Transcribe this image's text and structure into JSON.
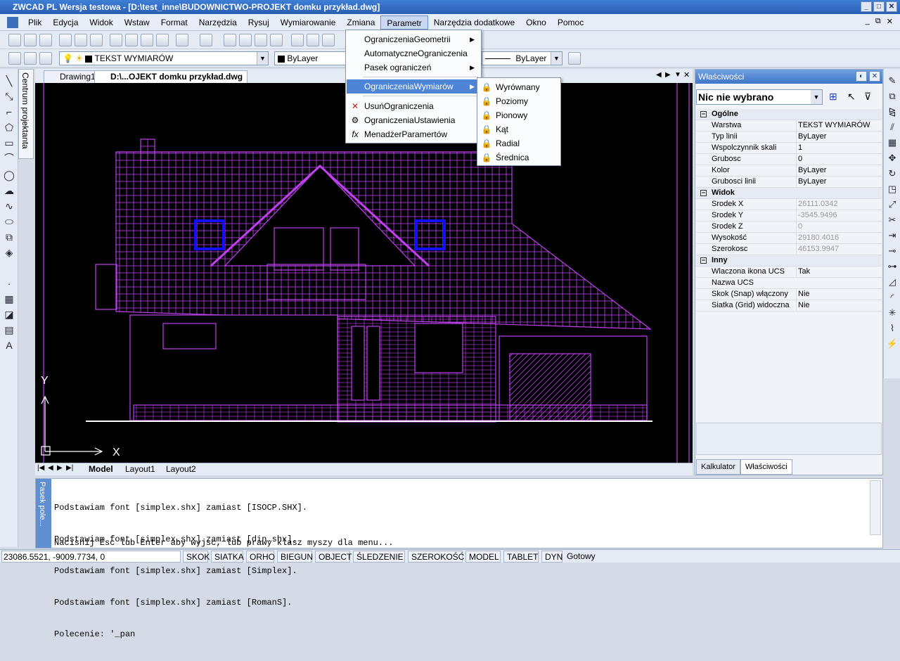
{
  "window": {
    "title": "ZWCAD PL Wersja testowa - [D:\\test_inne\\BUDOWNICTWO-PROJEKT domku przykład.dwg]",
    "min_label": "_",
    "max_label": "□",
    "close_label": "✕"
  },
  "menu": {
    "items": [
      "Plik",
      "Edycja",
      "Widok",
      "Wstaw",
      "Format",
      "Narzędzia",
      "Rysuj",
      "Wymiarowanie",
      "Zmiana",
      "Parametr",
      "Narzędzia dodatkowe",
      "Okno",
      "Pomoc"
    ],
    "active": "Parametr",
    "doc_controls": [
      "_",
      "⧉",
      "✕"
    ]
  },
  "toolbar2": {
    "layer_value": "TEKST WYMIARÓW",
    "color_value": "ByLayer",
    "linetype_value": "ByLayer"
  },
  "centrum_label": "Centrum projektanta",
  "doc_tabs": [
    "Drawing1",
    "D:\\...OJEKT domku przykład.dwg"
  ],
  "layout_tabs": [
    "Model",
    "Layout1",
    "Layout2"
  ],
  "dropdown": {
    "items": [
      {
        "label": "OgraniczeniaGeometrii",
        "submenu": true
      },
      {
        "label": "AutomatyczneOgraniczenia",
        "submenu": false
      },
      {
        "label": "Pasek ograniczeń",
        "submenu": true
      },
      {
        "label": "OgraniczeniaWymiarów",
        "submenu": true
      },
      {
        "label": "UsuńOgraniczenia",
        "submenu": false
      },
      {
        "label": "OgraniczeniaUstawienia",
        "submenu": false
      },
      {
        "label": "MenadżerParamertów",
        "submenu": false
      }
    ],
    "highlighted": "OgraniczeniaWymiarów",
    "submenu_items": [
      "Wyrównany",
      "Poziomy",
      "Pionowy",
      "Kąt",
      "Radial",
      "Średnica"
    ]
  },
  "properties": {
    "title": "Właściwości",
    "selection": "Nic nie wybrano",
    "categories": [
      {
        "name": "Ogólne",
        "rows": [
          {
            "k": "Warstwa",
            "v": "TEKST WYMIARÓW",
            "gray": false
          },
          {
            "k": "Typ linii",
            "v": "ByLayer",
            "gray": false
          },
          {
            "k": "Wspolczynnik skali",
            "v": "1",
            "gray": false
          },
          {
            "k": "Grubosc",
            "v": "0",
            "gray": false
          },
          {
            "k": "Kolor",
            "v": "ByLayer",
            "gray": false
          },
          {
            "k": "Grubosci linii",
            "v": "ByLayer",
            "gray": false
          }
        ]
      },
      {
        "name": "Widok",
        "rows": [
          {
            "k": "Srodek X",
            "v": "26111.0342",
            "gray": true
          },
          {
            "k": "Srodek Y",
            "v": "-3545.9496",
            "gray": true
          },
          {
            "k": "Srodek Z",
            "v": "0",
            "gray": true
          },
          {
            "k": "Wysokość",
            "v": "29180.4016",
            "gray": true
          },
          {
            "k": "Szerokosc",
            "v": "46153.9947",
            "gray": true
          }
        ]
      },
      {
        "name": "Inny",
        "rows": [
          {
            "k": "Wlaczona ikona UCS",
            "v": "Tak",
            "gray": false
          },
          {
            "k": "Nazwa UCS",
            "v": "",
            "gray": false
          },
          {
            "k": "Skok (Snap) włączony",
            "v": "Nie",
            "gray": false
          },
          {
            "k": "Siatka (Grid) widoczna",
            "v": "Nie",
            "gray": false
          }
        ]
      }
    ],
    "tabs": [
      "Kalkulator",
      "Właściwości"
    ]
  },
  "command": {
    "side_label": "Pasek pole...",
    "lines": [
      "Podstawiam font [simplex.shx] zamiast [ISOCP.SHX].",
      "Podstawiam font [simplex.shx] zamiast [din.shx].",
      "Podstawiam font [simplex.shx] zamiast [Simplex].",
      "Podstawiam font [simplex.shx] zamiast [RomanS].",
      "Polecenie: '_pan"
    ],
    "prompt": "Nacisnij Esc lub Enter aby wyjsc, lub prawy klasz myszy dla menu..."
  },
  "status": {
    "coords": "23086.5521,  -9009.7734,  0",
    "buttons": [
      "SKOK",
      "SIATKA",
      "ORHO",
      "BIEGUN",
      "OBJECT",
      "ŚLEDZENIE",
      "SZEROKOŚĆ",
      "MODEL",
      "TABLET",
      "DYN"
    ],
    "state": "Gotowy"
  },
  "ucs": {
    "x_label": "X",
    "y_label": "Y"
  },
  "colors": {
    "drawing": "#c040f0",
    "accent": "#4d84d6",
    "canvas": "#000000"
  }
}
